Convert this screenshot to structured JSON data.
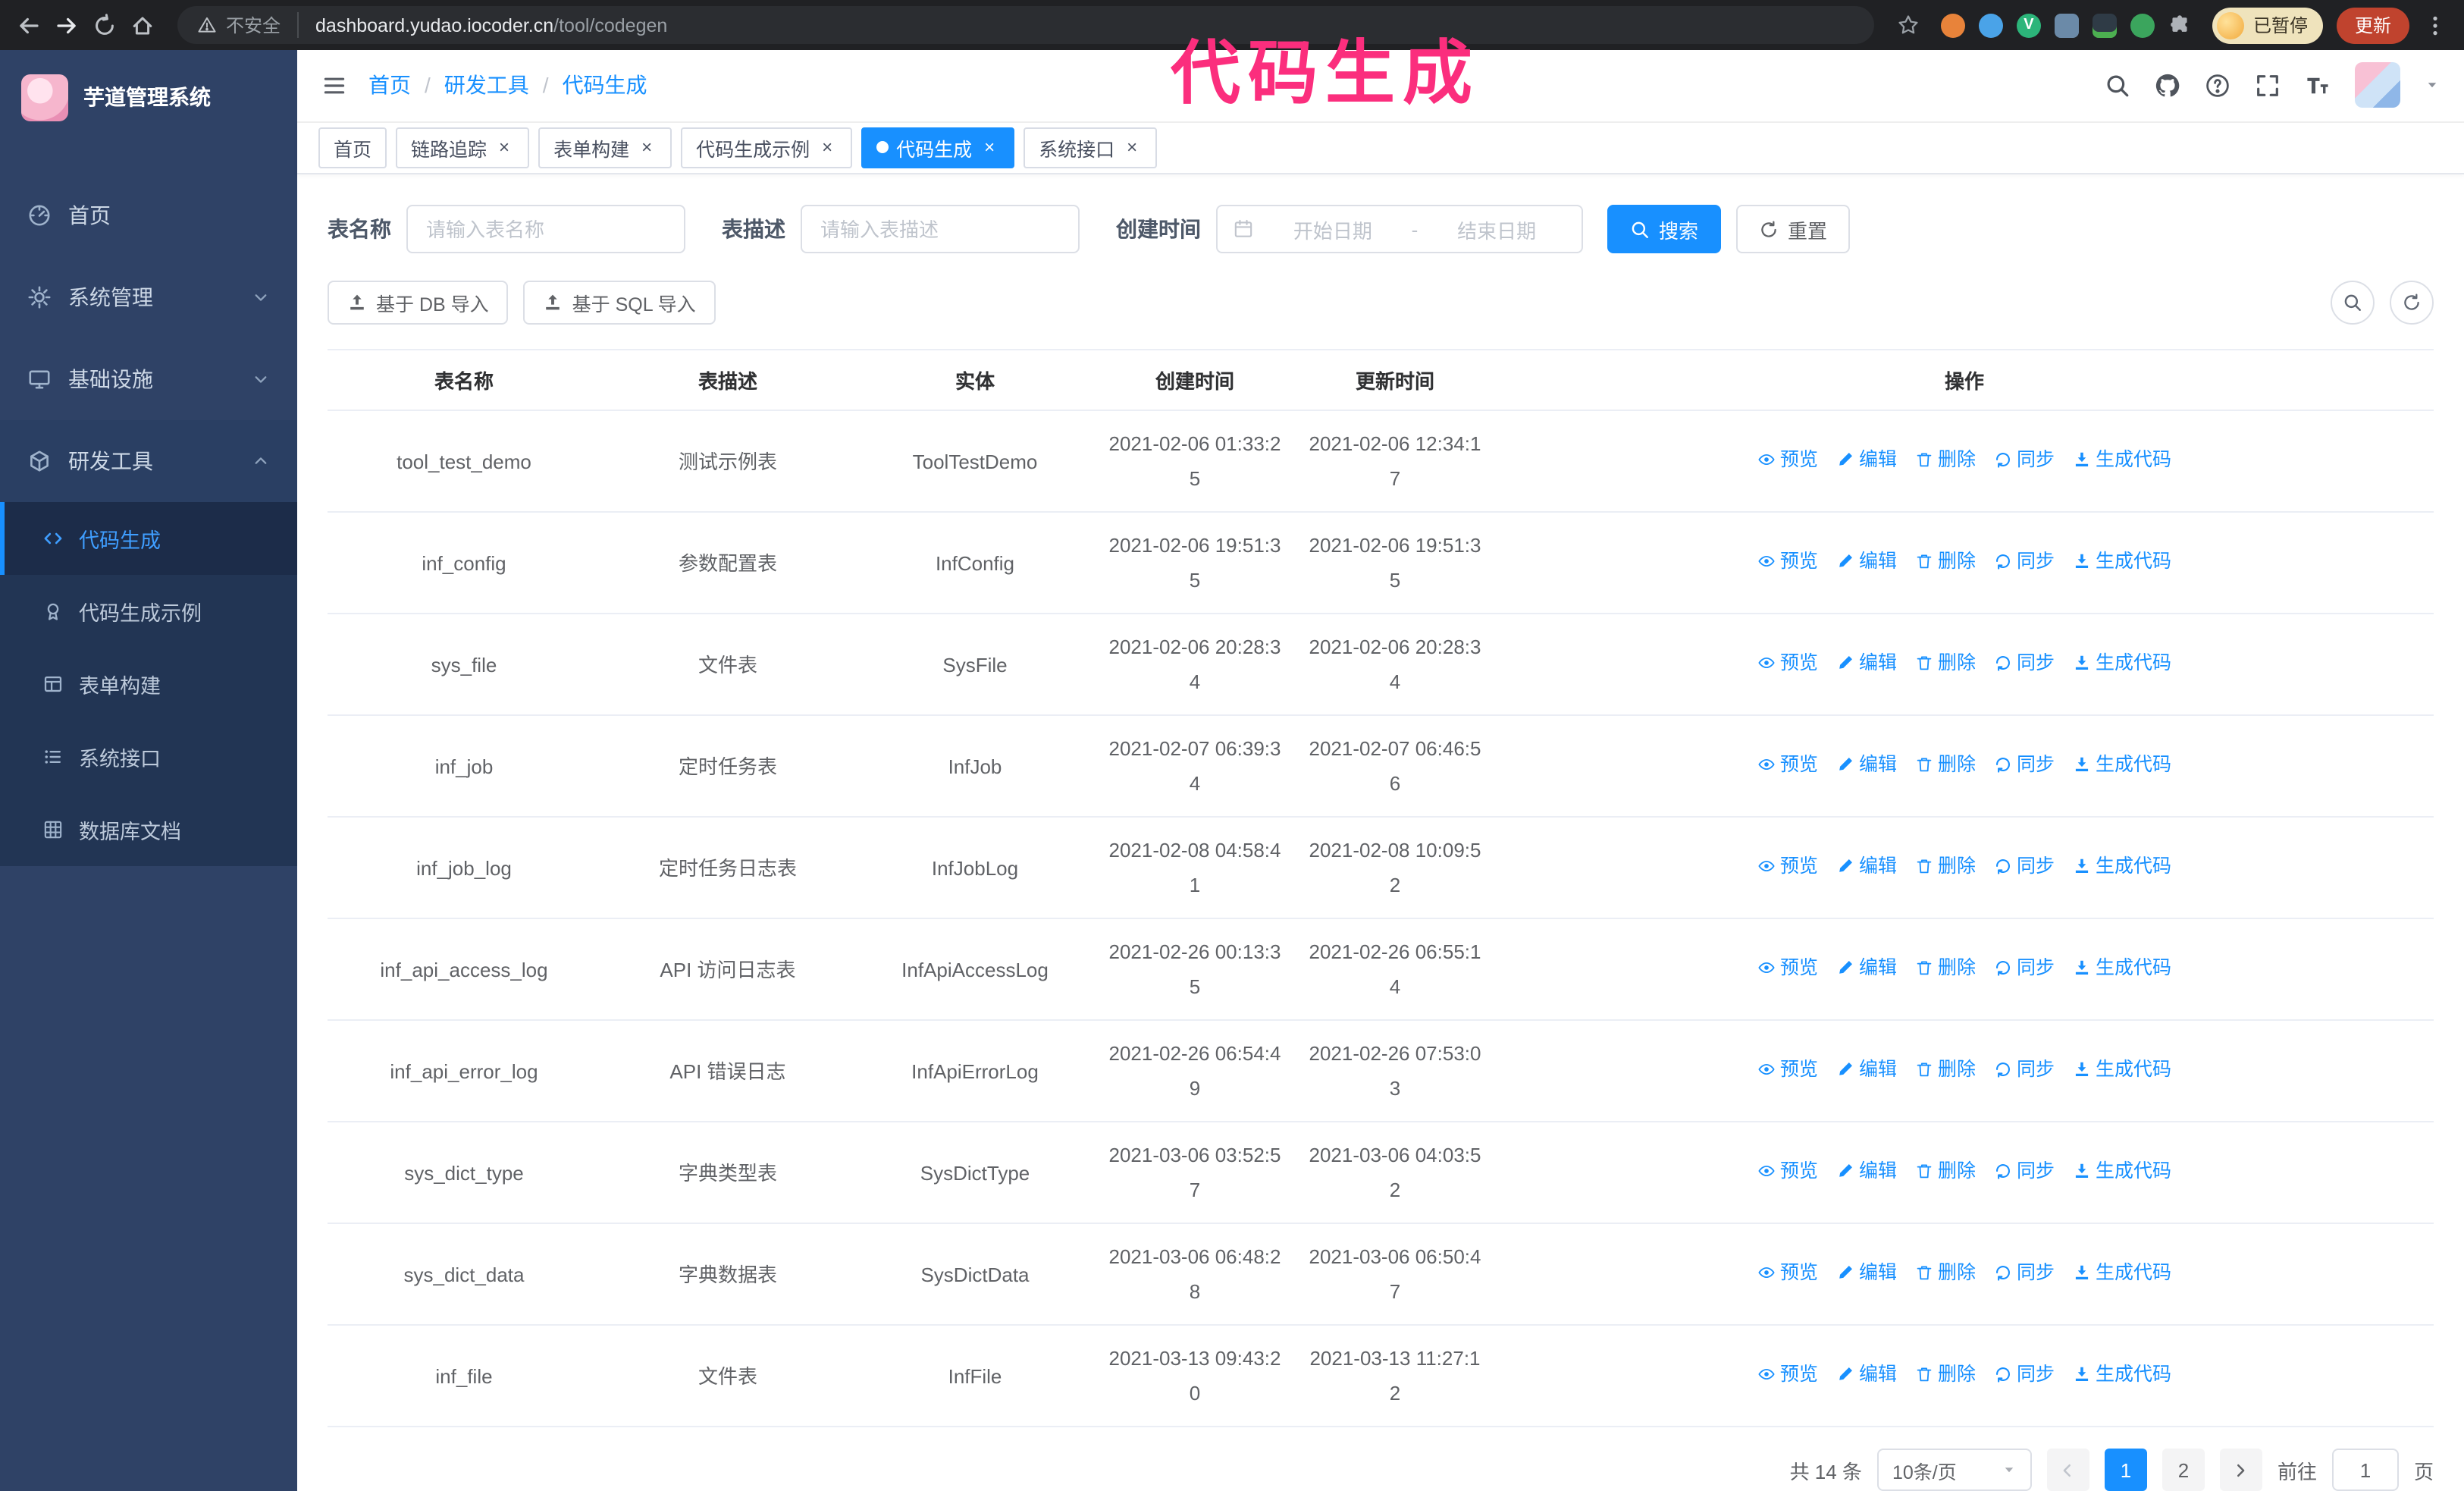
{
  "colors": {
    "primary": "#1890ff",
    "sidebar_bg": "#2f4266",
    "sidebar_submenu_bg": "#223554",
    "annotation_pink": "#fb2e7d",
    "active_menu_text": "#3f9eff"
  },
  "browser": {
    "security_label": "不安全",
    "url_host": "dashboard.yudao.iocoder.cn",
    "url_path": "/tool/codegen",
    "profile_badge": "已暂停",
    "update_button": "更新"
  },
  "annotation": {
    "text": "代码生成"
  },
  "sidebar": {
    "logo_title": "芋道管理系统",
    "items": [
      {
        "label": "首页",
        "icon": "dashboard-icon"
      },
      {
        "label": "系统管理",
        "icon": "gear-icon"
      },
      {
        "label": "基础设施",
        "icon": "monitor-icon"
      },
      {
        "label": "研发工具",
        "icon": "toolbox-icon"
      }
    ],
    "submenu": [
      {
        "label": "代码生成",
        "icon": "code-icon",
        "active": true
      },
      {
        "label": "代码生成示例",
        "icon": "badge-icon"
      },
      {
        "label": "表单构建",
        "icon": "form-icon"
      },
      {
        "label": "系统接口",
        "icon": "api-list-icon"
      },
      {
        "label": "数据库文档",
        "icon": "db-doc-icon"
      }
    ]
  },
  "header": {
    "breadcrumb": [
      {
        "label": "首页"
      },
      {
        "label": "研发工具"
      },
      {
        "label": "代码生成"
      }
    ]
  },
  "tabs": [
    {
      "label": "首页"
    },
    {
      "label": "链路追踪"
    },
    {
      "label": "表单构建"
    },
    {
      "label": "代码生成示例"
    },
    {
      "label": "代码生成",
      "active": true
    },
    {
      "label": "系统接口"
    }
  ],
  "filters": {
    "table_name_label": "表名称",
    "table_name_placeholder": "请输入表名称",
    "table_desc_label": "表描述",
    "table_desc_placeholder": "请输入表描述",
    "create_time_label": "创建时间",
    "date_start_placeholder": "开始日期",
    "date_separator": "-",
    "date_end_placeholder": "结束日期",
    "search_label": "搜索",
    "reset_label": "重置"
  },
  "toolbar": {
    "import_db_label": "基于 DB 导入",
    "import_sql_label": "基于 SQL 导入"
  },
  "table": {
    "columns": [
      "表名称",
      "表描述",
      "实体",
      "创建时间",
      "更新时间",
      "操作"
    ],
    "actions": [
      {
        "name": "preview",
        "label": "预览",
        "icon": "eye-icon"
      },
      {
        "name": "edit",
        "label": "编辑",
        "icon": "edit-icon"
      },
      {
        "name": "delete",
        "label": "删除",
        "icon": "delete-icon"
      },
      {
        "name": "sync",
        "label": "同步",
        "icon": "sync-icon"
      },
      {
        "name": "generate",
        "label": "生成代码",
        "icon": "download-icon"
      }
    ],
    "rows": [
      {
        "name": "tool_test_demo",
        "desc": "测试示例表",
        "entity": "ToolTestDemo",
        "created": "2021-02-06 01:33:25",
        "updated": "2021-02-06 12:34:17"
      },
      {
        "name": "inf_config",
        "desc": "参数配置表",
        "entity": "InfConfig",
        "created": "2021-02-06 19:51:35",
        "updated": "2021-02-06 19:51:35"
      },
      {
        "name": "sys_file",
        "desc": "文件表",
        "entity": "SysFile",
        "created": "2021-02-06 20:28:34",
        "updated": "2021-02-06 20:28:34"
      },
      {
        "name": "inf_job",
        "desc": "定时任务表",
        "entity": "InfJob",
        "created": "2021-02-07 06:39:34",
        "updated": "2021-02-07 06:46:56"
      },
      {
        "name": "inf_job_log",
        "desc": "定时任务日志表",
        "entity": "InfJobLog",
        "created": "2021-02-08 04:58:41",
        "updated": "2021-02-08 10:09:52"
      },
      {
        "name": "inf_api_access_log",
        "desc": "API 访问日志表",
        "entity": "InfApiAccessLog",
        "created": "2021-02-26 00:13:35",
        "updated": "2021-02-26 06:55:14"
      },
      {
        "name": "inf_api_error_log",
        "desc": "API 错误日志",
        "entity": "InfApiErrorLog",
        "created": "2021-02-26 06:54:49",
        "updated": "2021-02-26 07:53:03"
      },
      {
        "name": "sys_dict_type",
        "desc": "字典类型表",
        "entity": "SysDictType",
        "created": "2021-03-06 03:52:57",
        "updated": "2021-03-06 04:03:52"
      },
      {
        "name": "sys_dict_data",
        "desc": "字典数据表",
        "entity": "SysDictData",
        "created": "2021-03-06 06:48:28",
        "updated": "2021-03-06 06:50:47"
      },
      {
        "name": "inf_file",
        "desc": "文件表",
        "entity": "InfFile",
        "created": "2021-03-13 09:43:20",
        "updated": "2021-03-13 11:27:12"
      }
    ]
  },
  "pagination": {
    "total_label": "共 14 条",
    "page_size_label": "10条/页",
    "pages": [
      "1",
      "2"
    ],
    "active_page": "1",
    "goto_label": "前往",
    "goto_value": "1",
    "goto_suffix_label": "页"
  }
}
